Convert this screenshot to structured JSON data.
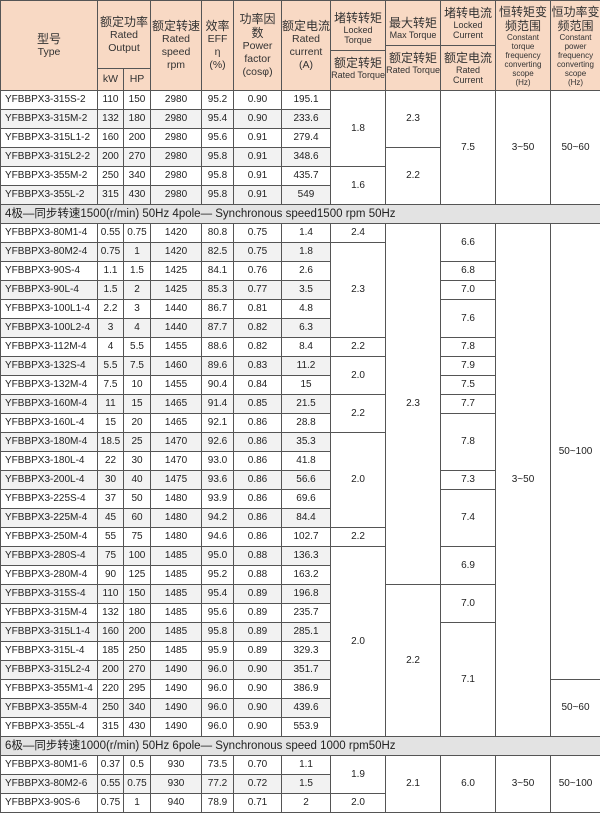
{
  "header": {
    "type": {
      "cn": "型号",
      "en": "Type"
    },
    "rated_output": {
      "cn": "额定功率",
      "en1": "Rated",
      "en2": "Output",
      "kw": "kW",
      "hp": "HP"
    },
    "rated_speed": {
      "cn": "额定转速",
      "en1": "Rated",
      "en2": "speed",
      "en3": "rpm"
    },
    "eff": {
      "cn": "效率",
      "en1": "EFF",
      "en2": "η",
      "en3": "(%)"
    },
    "pf": {
      "cn": "功率因数",
      "en1": "Power",
      "en2": "factor",
      "en3": "(cosφ)"
    },
    "current": {
      "cn": "额定电流",
      "en1": "Rated",
      "en2": "current",
      "en3": "(A)"
    },
    "locked_torque": {
      "cn": "堵转转矩",
      "en": "Locked Torque",
      "cn2": "额定转矩",
      "en2": "Rated Torque"
    },
    "max_torque": {
      "cn": "最大转矩",
      "en": "Max Torque",
      "cn2": "额定转矩",
      "en2": "Rated Torque"
    },
    "locked_current": {
      "cn": "堵转电流",
      "en": "Locked Current",
      "cn2": "额定电流",
      "en2": "Rated Current"
    },
    "ct_scope": {
      "cn1": "恒转矩变",
      "cn2": "频范围",
      "en1": "Constant torque",
      "en2": "frequency",
      "en3": "converting",
      "en4": "scope",
      "en5": "(Hz)"
    },
    "cp_scope": {
      "cn1": "恒功率变",
      "cn2": "频范围",
      "en1": "Constant power",
      "en2": "frequency",
      "en3": "converting",
      "en4": "scope",
      "en5": "(Hz)"
    }
  },
  "sections": [
    {
      "title": "",
      "rows": [
        [
          "YFBBPX3-315S-2",
          "110",
          "150",
          "2980",
          "95.2",
          "0.90",
          "195.1"
        ],
        [
          "YFBBPX3-315M-2",
          "132",
          "180",
          "2980",
          "95.4",
          "0.90",
          "233.6"
        ],
        [
          "YFBBPX3-315L1-2",
          "160",
          "200",
          "2980",
          "95.6",
          "0.91",
          "279.4"
        ],
        [
          "YFBBPX3-315L2-2",
          "200",
          "270",
          "2980",
          "95.8",
          "0.91",
          "348.6"
        ],
        [
          "YFBBPX3-355M-2",
          "250",
          "340",
          "2980",
          "95.8",
          "0.91",
          "435.7"
        ],
        [
          "YFBBPX3-355L-2",
          "315",
          "430",
          "2980",
          "95.8",
          "0.91",
          "549"
        ]
      ],
      "locked_torque": [
        {
          "v": "1.8",
          "span": 4
        },
        {
          "v": "1.6",
          "span": 2
        }
      ],
      "max_torque": [
        {
          "v": "2.3",
          "span": 3
        },
        {
          "v": "2.2",
          "span": 3
        }
      ],
      "locked_current": [
        {
          "v": "7.5",
          "span": 6
        }
      ],
      "ct_scope": [
        {
          "v": "3~50",
          "span": 6
        }
      ],
      "cp_scope": [
        {
          "v": "50~60",
          "span": 6
        }
      ]
    },
    {
      "title": "4极—同步转速1500(r/min) 50Hz  4pole— Synchronous speed1500 rpm 50Hz",
      "rows": [
        [
          "YFBBPX3-80M1-4",
          "0.55",
          "0.75",
          "1420",
          "80.8",
          "0.75",
          "1.4"
        ],
        [
          "YFBBPX3-80M2-4",
          "0.75",
          "1",
          "1420",
          "82.5",
          "0.75",
          "1.8"
        ],
        [
          "YFBBPX3-90S-4",
          "1.1",
          "1.5",
          "1425",
          "84.1",
          "0.76",
          "2.6"
        ],
        [
          "YFBBPX3-90L-4",
          "1.5",
          "2",
          "1425",
          "85.3",
          "0.77",
          "3.5"
        ],
        [
          "YFBBPX3-100L1-4",
          "2.2",
          "3",
          "1440",
          "86.7",
          "0.81",
          "4.8"
        ],
        [
          "YFBBPX3-100L2-4",
          "3",
          "4",
          "1440",
          "87.7",
          "0.82",
          "6.3"
        ],
        [
          "YFBBPX3-112M-4",
          "4",
          "5.5",
          "1455",
          "88.6",
          "0.82",
          "8.4"
        ],
        [
          "YFBBPX3-132S-4",
          "5.5",
          "7.5",
          "1460",
          "89.6",
          "0.83",
          "11.2"
        ],
        [
          "YFBBPX3-132M-4",
          "7.5",
          "10",
          "1455",
          "90.4",
          "0.84",
          "15"
        ],
        [
          "YFBBPX3-160M-4",
          "11",
          "15",
          "1465",
          "91.4",
          "0.85",
          "21.5"
        ],
        [
          "YFBBPX3-160L-4",
          "15",
          "20",
          "1465",
          "92.1",
          "0.86",
          "28.8"
        ],
        [
          "YFBBPX3-180M-4",
          "18.5",
          "25",
          "1470",
          "92.6",
          "0.86",
          "35.3"
        ],
        [
          "YFBBPX3-180L-4",
          "22",
          "30",
          "1470",
          "93.0",
          "0.86",
          "41.8"
        ],
        [
          "YFBBPX3-200L-4",
          "30",
          "40",
          "1475",
          "93.6",
          "0.86",
          "56.6"
        ],
        [
          "YFBBPX3-225S-4",
          "37",
          "50",
          "1480",
          "93.9",
          "0.86",
          "69.6"
        ],
        [
          "YFBBPX3-225M-4",
          "45",
          "60",
          "1480",
          "94.2",
          "0.86",
          "84.4"
        ],
        [
          "YFBBPX3-250M-4",
          "55",
          "75",
          "1480",
          "94.6",
          "0.86",
          "102.7"
        ],
        [
          "YFBBPX3-280S-4",
          "75",
          "100",
          "1485",
          "95.0",
          "0.88",
          "136.3"
        ],
        [
          "YFBBPX3-280M-4",
          "90",
          "125",
          "1485",
          "95.2",
          "0.88",
          "163.2"
        ],
        [
          "YFBBPX3-315S-4",
          "110",
          "150",
          "1485",
          "95.4",
          "0.89",
          "196.8"
        ],
        [
          "YFBBPX3-315M-4",
          "132",
          "180",
          "1485",
          "95.6",
          "0.89",
          "235.7"
        ],
        [
          "YFBBPX3-315L1-4",
          "160",
          "200",
          "1485",
          "95.8",
          "0.89",
          "285.1"
        ],
        [
          "YFBBPX3-315L-4",
          "185",
          "250",
          "1485",
          "95.9",
          "0.89",
          "329.3"
        ],
        [
          "YFBBPX3-315L2-4",
          "200",
          "270",
          "1490",
          "96.0",
          "0.90",
          "351.7"
        ],
        [
          "YFBBPX3-355M1-4",
          "220",
          "295",
          "1490",
          "96.0",
          "0.90",
          "386.9"
        ],
        [
          "YFBBPX3-355M-4",
          "250",
          "340",
          "1490",
          "96.0",
          "0.90",
          "439.6"
        ],
        [
          "YFBBPX3-355L-4",
          "315",
          "430",
          "1490",
          "96.0",
          "0.90",
          "553.9"
        ]
      ],
      "locked_torque": [
        {
          "v": "2.4",
          "span": 1
        },
        {
          "v": "2.3",
          "span": 5
        },
        {
          "v": "2.2",
          "span": 1
        },
        {
          "v": "2.0",
          "span": 2
        },
        {
          "v": "2.2",
          "span": 2
        },
        {
          "v": "2.0",
          "span": 5
        },
        {
          "v": "2.2",
          "span": 1
        },
        {
          "v": "2.0",
          "span": 10
        }
      ],
      "max_torque": [
        {
          "v": "2.3",
          "span": 19
        },
        {
          "v": "2.2",
          "span": 8
        }
      ],
      "locked_current": [
        {
          "v": "6.6",
          "span": 2
        },
        {
          "v": "6.8",
          "span": 1
        },
        {
          "v": "7.0",
          "span": 1
        },
        {
          "v": "7.6",
          "span": 2
        },
        {
          "v": "7.8",
          "span": 1
        },
        {
          "v": "7.9",
          "span": 1
        },
        {
          "v": "7.5",
          "span": 1
        },
        {
          "v": "7.7",
          "span": 1
        },
        {
          "v": "7.8",
          "span": 3
        },
        {
          "v": "7.3",
          "span": 1
        },
        {
          "v": "7.4",
          "span": 3
        },
        {
          "v": "6.9",
          "span": 2
        },
        {
          "v": "7.0",
          "span": 2
        },
        {
          "v": "7.1",
          "span": 6
        }
      ],
      "ct_scope": [
        {
          "v": "3~50",
          "span": 27
        }
      ],
      "cp_scope": [
        {
          "v": "50~100",
          "span": 24
        },
        {
          "v": "50~60",
          "span": 3
        }
      ]
    },
    {
      "title": "6极—同步转速1000(r/min) 50Hz  6pole— Synchronous speed 1000 rpm50Hz",
      "rows": [
        [
          "YFBBPX3-80M1-6",
          "0.37",
          "0.5",
          "930",
          "73.5",
          "0.70",
          "1.1"
        ],
        [
          "YFBBPX3-80M2-6",
          "0.55",
          "0.75",
          "930",
          "77.2",
          "0.72",
          "1.5"
        ],
        [
          "YFBBPX3-90S-6",
          "0.75",
          "1",
          "940",
          "78.9",
          "0.71",
          "2"
        ]
      ],
      "locked_torque": [
        {
          "v": "1.9",
          "span": 2
        },
        {
          "v": "2.0",
          "span": 1
        }
      ],
      "max_torque": [
        {
          "v": "2.1",
          "span": 3
        }
      ],
      "locked_current": [
        {
          "v": "6.0",
          "span": 3
        }
      ],
      "ct_scope": [
        {
          "v": "3~50",
          "span": 3
        }
      ],
      "cp_scope": [
        {
          "v": "50~100",
          "span": 3
        }
      ]
    }
  ]
}
